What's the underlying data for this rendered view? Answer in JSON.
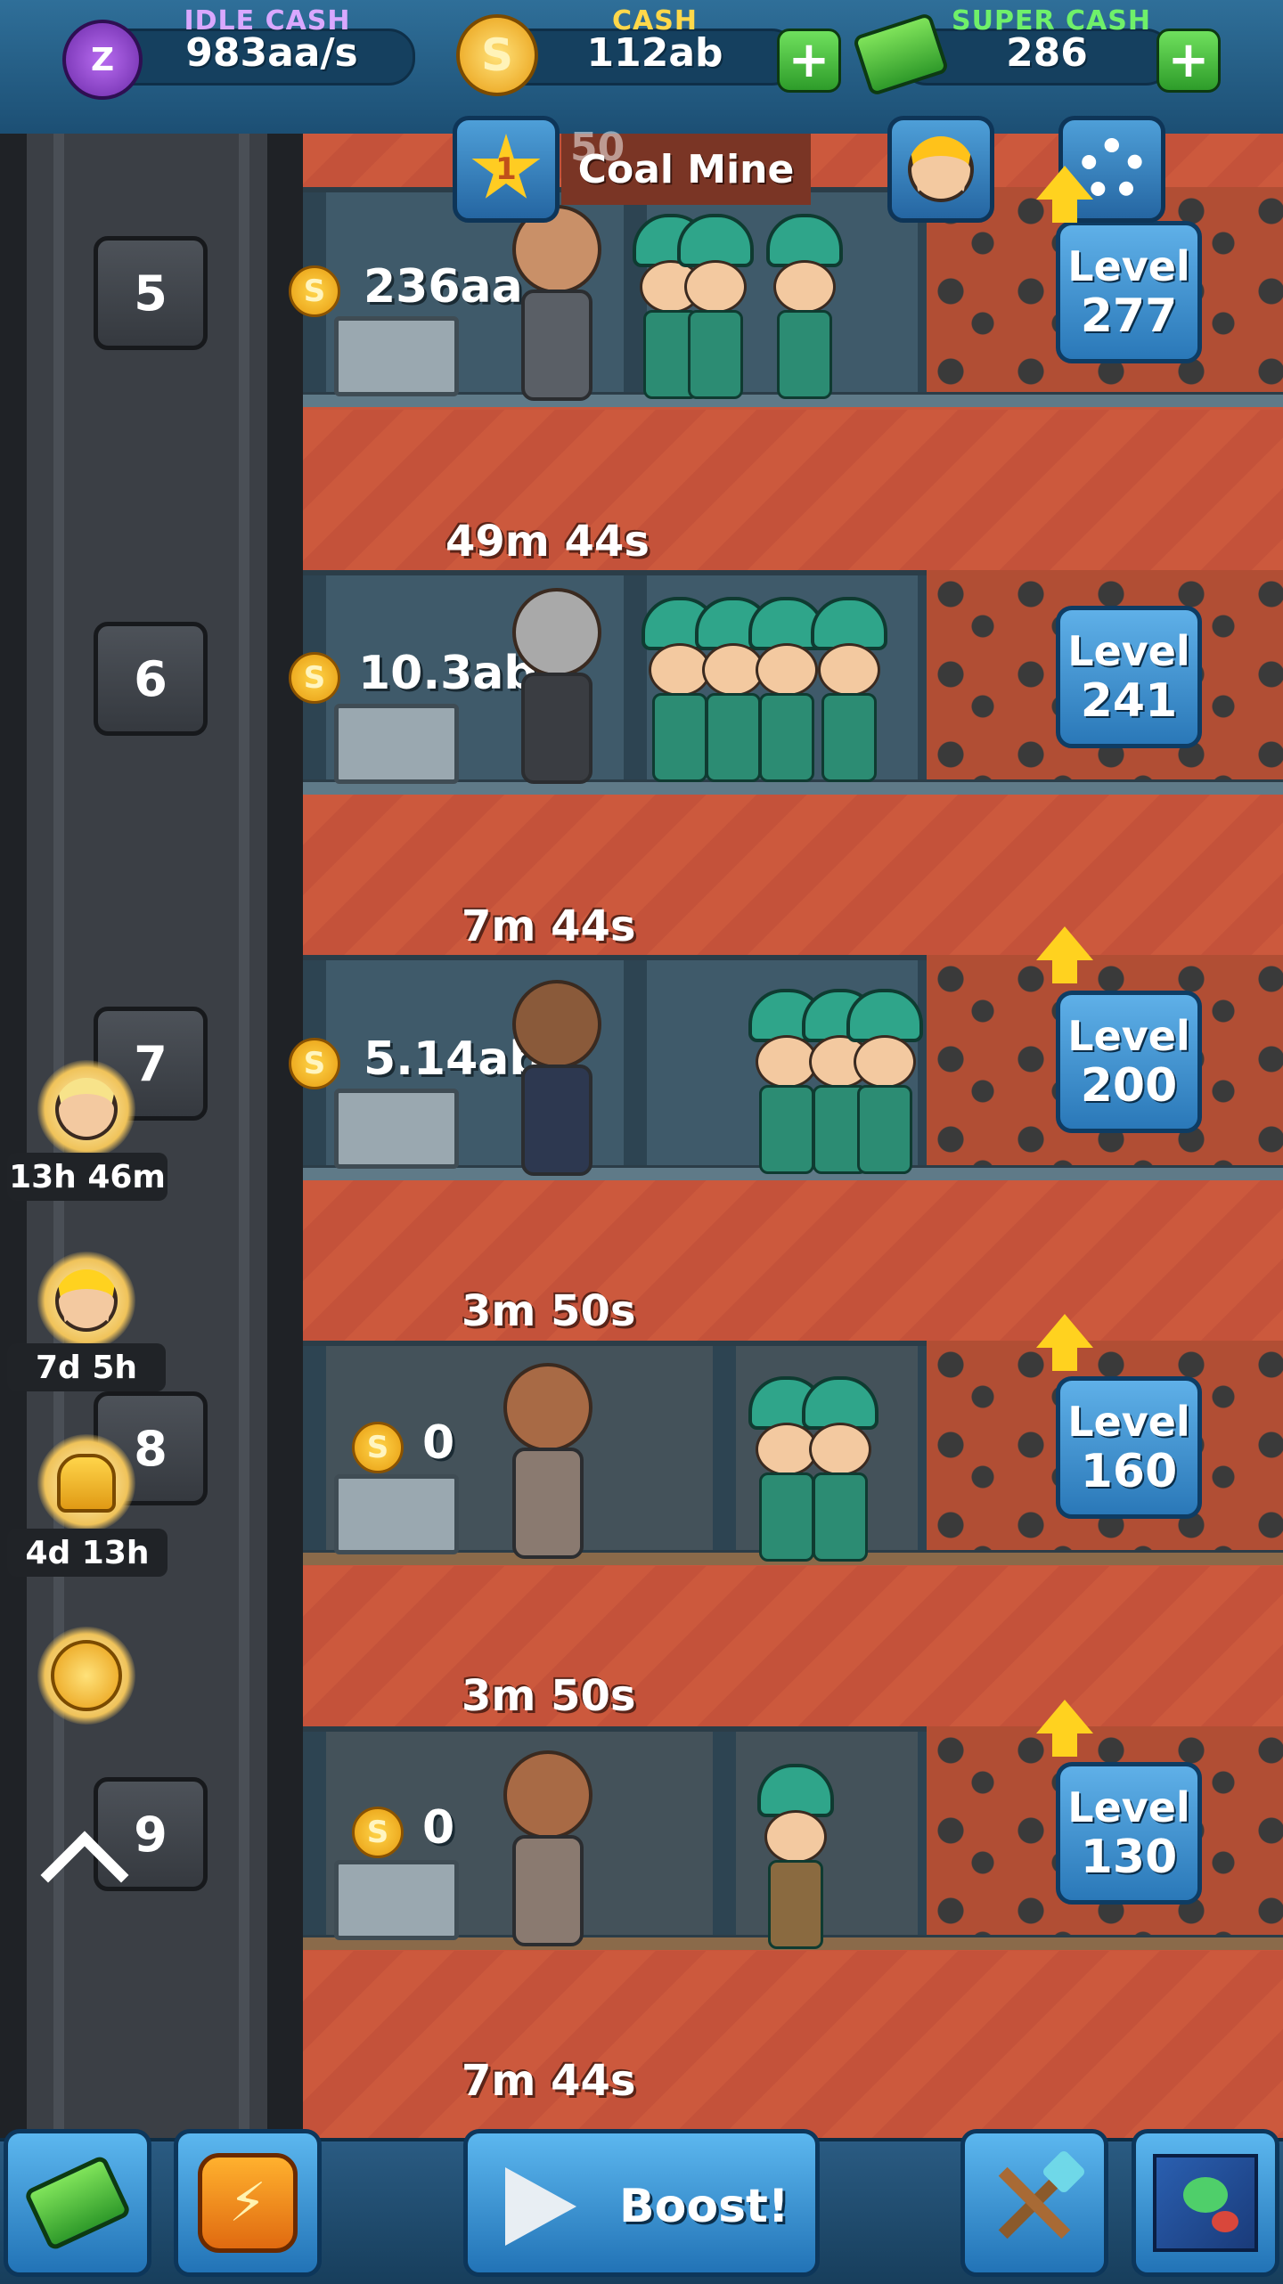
{
  "topbar": {
    "idle_cash": {
      "label": "IDLE CASH",
      "value": "983aa/s",
      "icon": "zzz-icon",
      "label_color": "#d9a8ff"
    },
    "cash": {
      "label": "CASH",
      "value": "112ab",
      "icon": "coin-icon",
      "label_color": "#ffd84a"
    },
    "super_cash": {
      "label": "SUPER CASH",
      "value": "286",
      "icon": "money-stack-icon",
      "label_color": "#6ff06a"
    },
    "plus_label": "+"
  },
  "header": {
    "prestige_star_value": "1",
    "mine_name": "Coal Mine",
    "partial_number": "50"
  },
  "floors": [
    {
      "number": "5",
      "timer": "",
      "stash": "236aa",
      "level_label": "Level",
      "level": "277",
      "upgrade_arrow": true
    },
    {
      "number": "6",
      "timer": "49m 44s",
      "stash": "10.3ab",
      "level_label": "Level",
      "level": "241",
      "upgrade_arrow": false
    },
    {
      "number": "7",
      "timer": "7m 44s",
      "stash": "5.14ab",
      "level_label": "Level",
      "level": "200",
      "upgrade_arrow": true
    },
    {
      "number": "8",
      "timer": "3m 50s",
      "stash": "0",
      "level_label": "Level",
      "level": "160",
      "upgrade_arrow": true
    },
    {
      "number": "9",
      "timer": "3m 50s",
      "stash": "0",
      "level_label": "Level",
      "level": "130",
      "upgrade_arrow": true
    }
  ],
  "next_timer": "7m 44s",
  "coin_glyph": "S",
  "boosts": [
    {
      "icon": "manager-boost-icon",
      "timer": "13h 46m"
    },
    {
      "icon": "goggles-boost-icon",
      "timer": "7d 5h"
    },
    {
      "icon": "bells-boost-icon",
      "timer": "4d 13h"
    },
    {
      "icon": "gold-coin-boost-icon",
      "timer": ""
    }
  ],
  "bottombar": {
    "shop_icon": "cash-stack-icon",
    "instant_icon": "lightning-coin-icon",
    "boost_label": "Boost!",
    "tools_icon": "pickaxe-shovel-icon",
    "map_icon": "world-map-icon"
  },
  "colors": {
    "dirt": "#c9563b",
    "level_button": "#2a78b8",
    "miner_helmet": "#2fa58a",
    "arrow": "#ffd21f"
  }
}
